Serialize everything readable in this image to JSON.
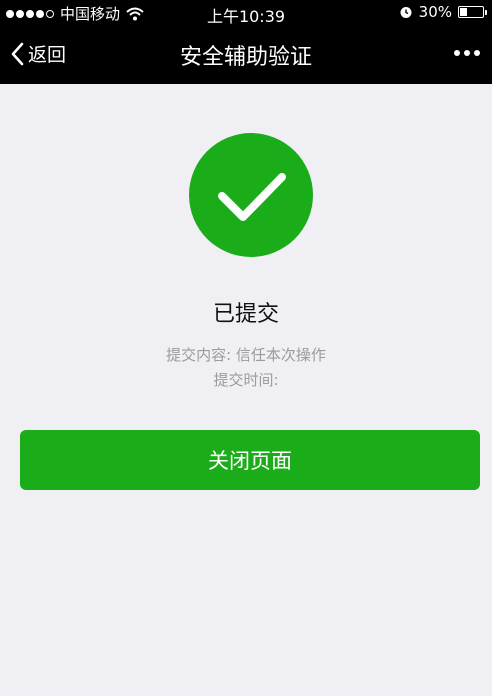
{
  "status_bar": {
    "carrier": "中国移动",
    "time": "上午10:39",
    "battery": "30%",
    "battery_level": 0.3
  },
  "nav": {
    "back_label": "返回",
    "title": "安全辅助验证"
  },
  "result": {
    "title": "已提交",
    "content_label": "提交内容: 信任本次操作",
    "time_label": "提交时间:"
  },
  "actions": {
    "close_label": "关闭页面"
  },
  "colors": {
    "accent": "#1aad19",
    "nav_background": "#000000",
    "page_background": "#efeff4"
  }
}
